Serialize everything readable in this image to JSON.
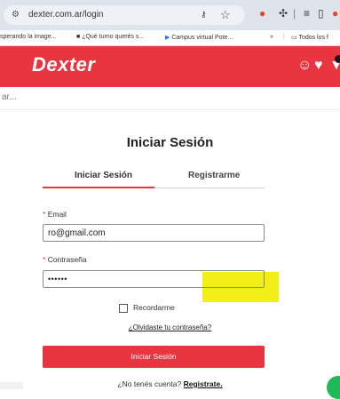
{
  "browser": {
    "url": "dexter.com.ar/login",
    "site_info_icon": "tune-icon",
    "key_icon": "password-key-icon",
    "bookmark_star_icon": "star-icon",
    "bookmarks": [
      {
        "label": "sperando la image..."
      },
      {
        "label": "¿Qué turno querés s..."
      },
      {
        "label": "Campus virtual Pote..."
      }
    ],
    "bookmarks_more": "»",
    "all_bookmarks": "Todos los f"
  },
  "header": {
    "logo": "Dexter",
    "bg_color": "#e8353f",
    "user_icon": "user-icon",
    "heart_icon": "heart-icon",
    "cart_icon": "cart-icon"
  },
  "breadcrumb": "ar...",
  "login": {
    "title": "Iniciar Sesión",
    "tabs": [
      {
        "label": "Iniciar Sesión",
        "active": true
      },
      {
        "label": "Registrarme",
        "active": false
      }
    ],
    "email_label": "Email",
    "email_value": "ro@gmail.com",
    "password_label": "Contraseña",
    "password_value": "••••••",
    "required_mark": "*",
    "remember_label": "Recordarme",
    "forgot_link": "¿Olvidaste tu contraseña?",
    "submit_label": "Iniciar Sesión",
    "no_account_text": "¿No tenés cuenta?",
    "register_link": "Registrate."
  }
}
